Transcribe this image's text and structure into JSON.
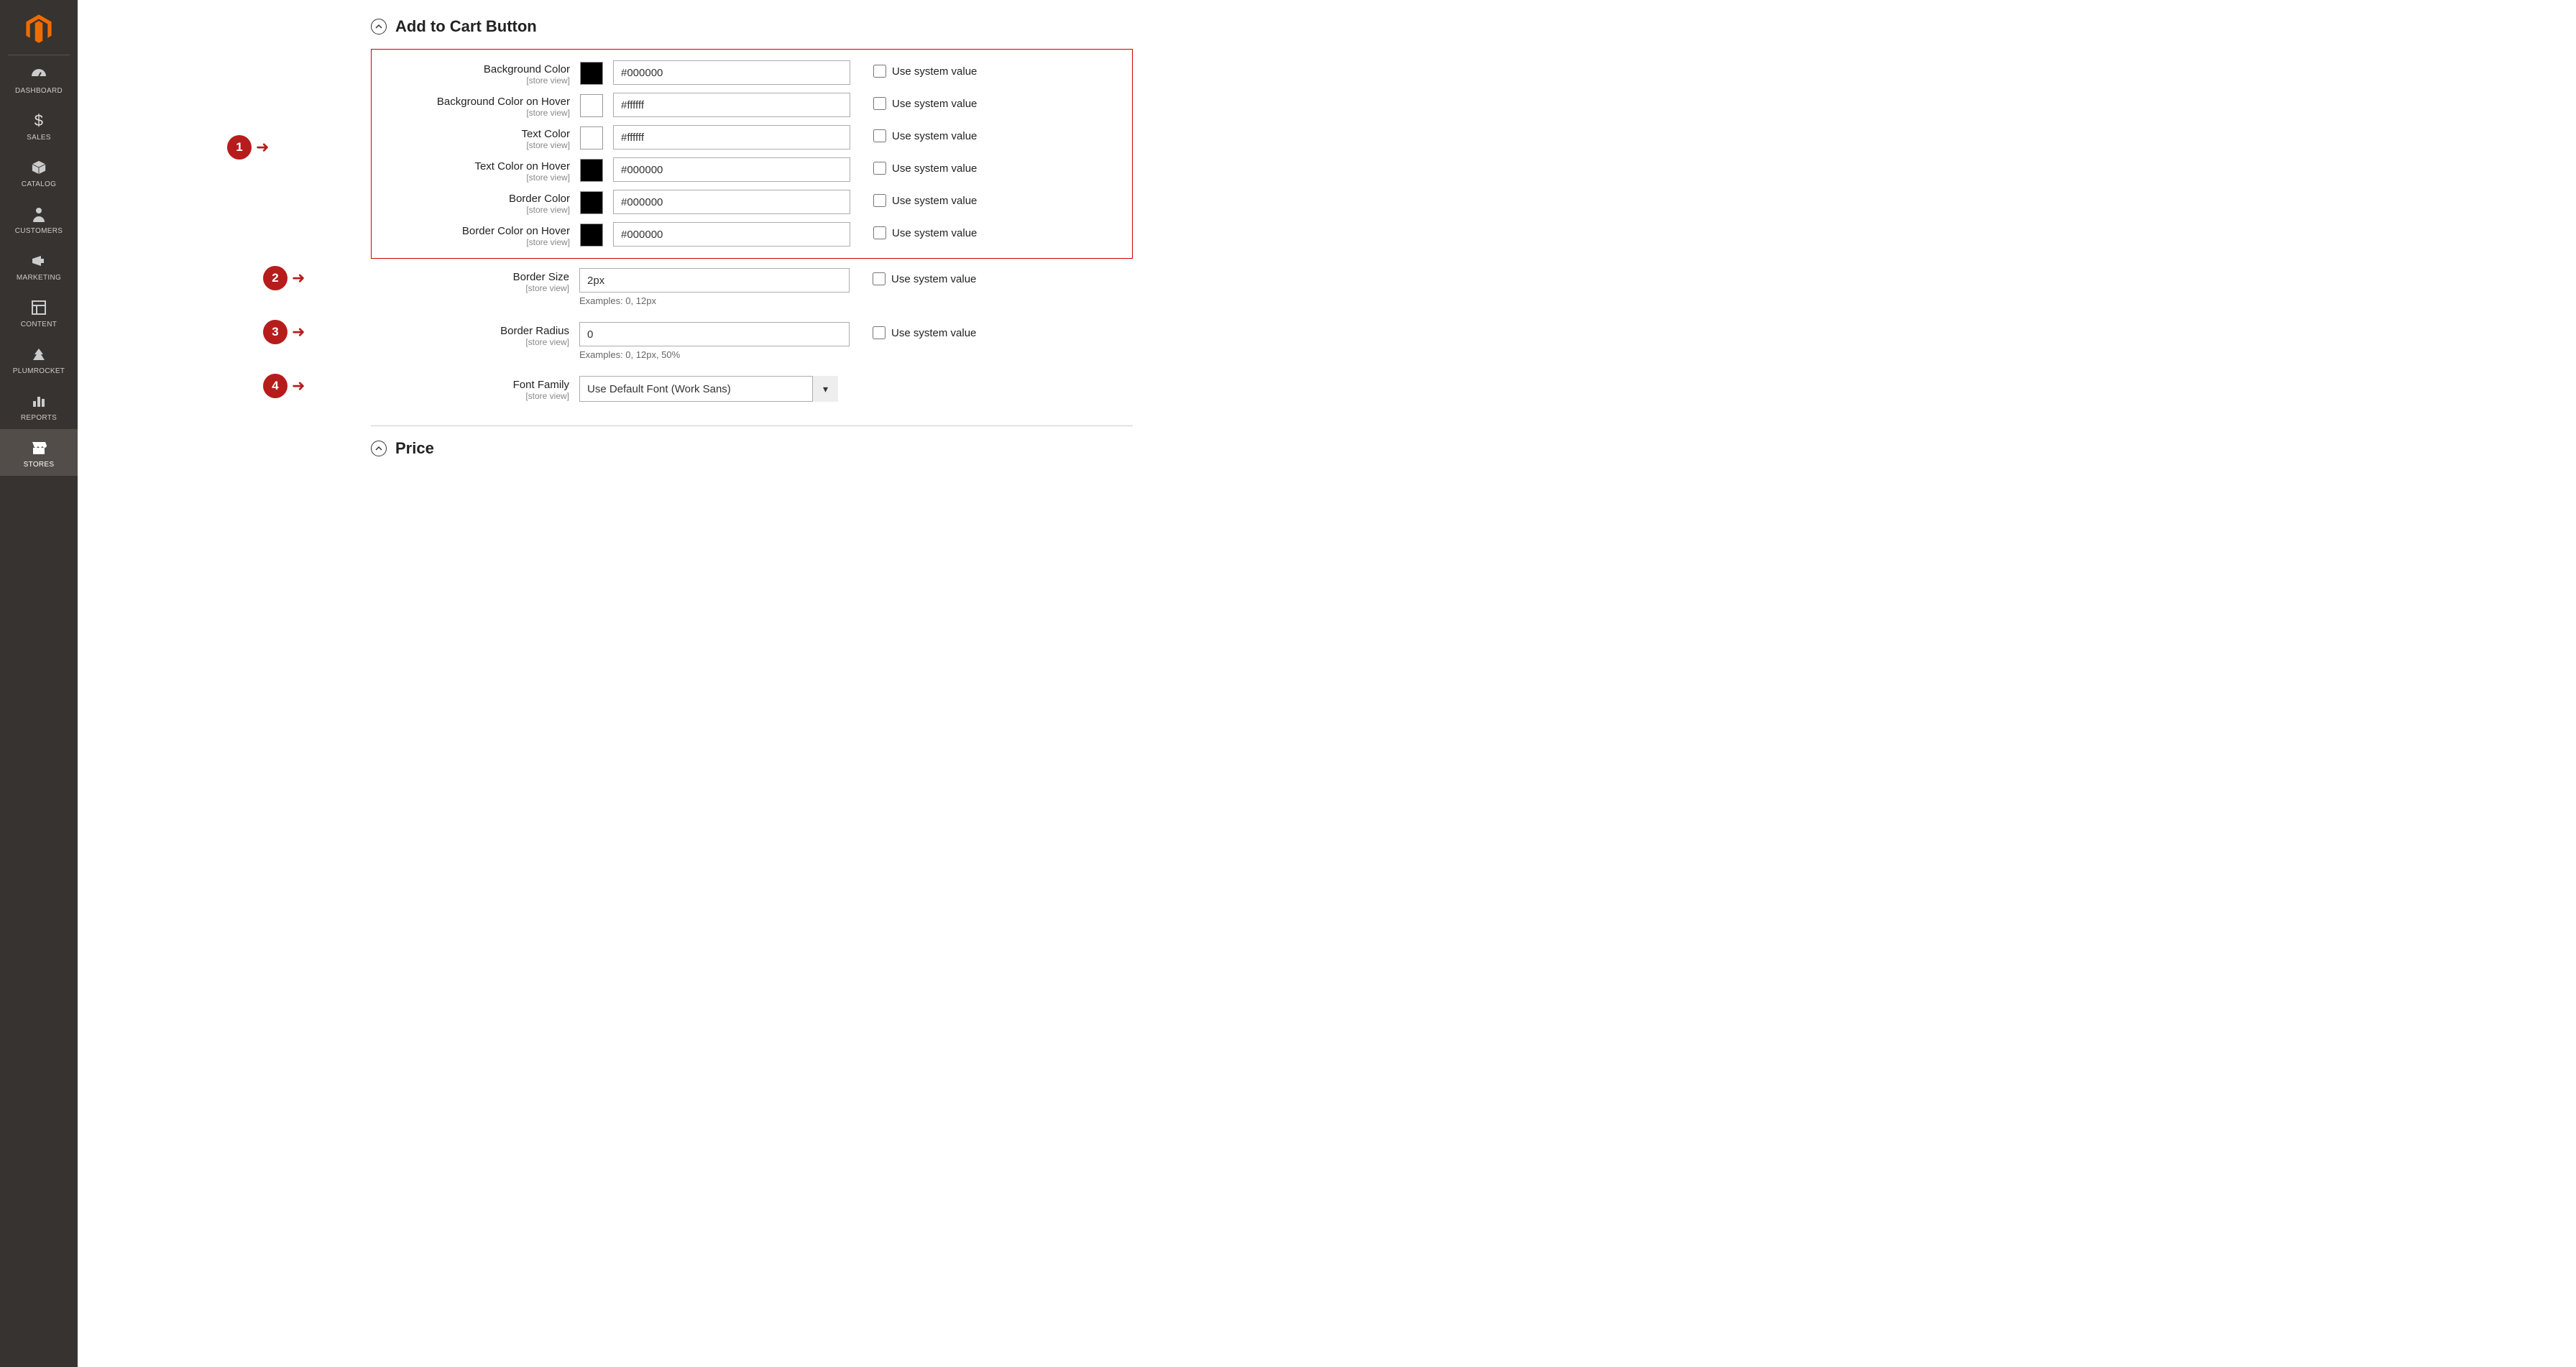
{
  "sidebar": {
    "items": [
      {
        "label": "DASHBOARD"
      },
      {
        "label": "SALES"
      },
      {
        "label": "CATALOG"
      },
      {
        "label": "CUSTOMERS"
      },
      {
        "label": "MARKETING"
      },
      {
        "label": "CONTENT"
      },
      {
        "label": "PLUMROCKET"
      },
      {
        "label": "REPORTS"
      },
      {
        "label": "STORES"
      }
    ]
  },
  "sections": {
    "add_to_cart": {
      "title": "Add to Cart Button"
    },
    "price": {
      "title": "Price"
    }
  },
  "fields": {
    "scope_label": "[store view]",
    "use_system_label": "Use system value",
    "bg_color": {
      "label": "Background Color",
      "value": "#000000",
      "swatch": "#000000"
    },
    "bg_color_hover": {
      "label": "Background Color on Hover",
      "value": "#ffffff",
      "swatch": "#ffffff"
    },
    "text_color": {
      "label": "Text Color",
      "value": "#ffffff",
      "swatch": "#ffffff"
    },
    "text_color_hover": {
      "label": "Text Color on Hover",
      "value": "#000000",
      "swatch": "#000000"
    },
    "border_color": {
      "label": "Border Color",
      "value": "#000000",
      "swatch": "#000000"
    },
    "border_color_hover": {
      "label": "Border Color on Hover",
      "value": "#000000",
      "swatch": "#000000"
    },
    "border_size": {
      "label": "Border Size",
      "value": "2px",
      "hint": "Examples: 0, 12px"
    },
    "border_radius": {
      "label": "Border Radius",
      "value": "0",
      "hint": "Examples: 0, 12px, 50%"
    },
    "font_family": {
      "label": "Font Family",
      "value": "Use Default Font (Work Sans)"
    }
  },
  "annotations": {
    "1": "1",
    "2": "2",
    "3": "3",
    "4": "4"
  }
}
